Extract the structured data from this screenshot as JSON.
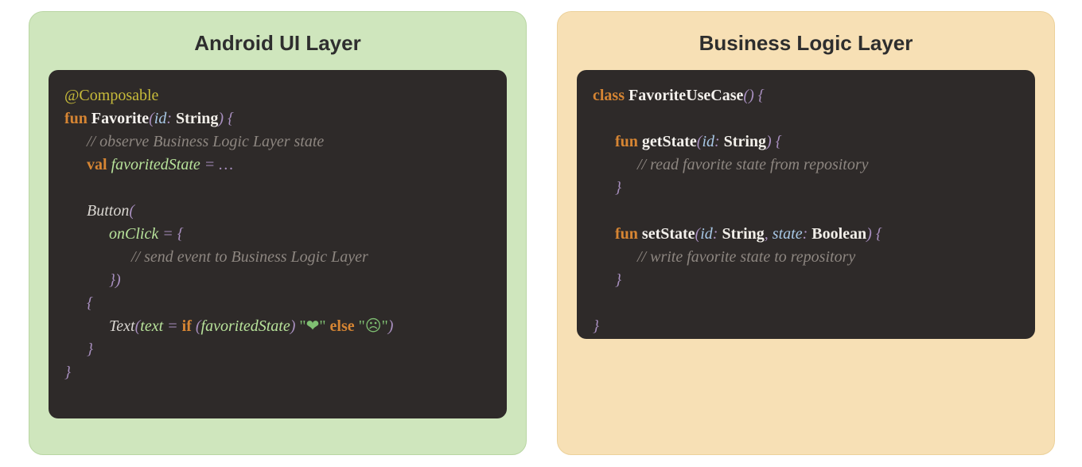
{
  "left": {
    "title": "Android UI Layer",
    "code": {
      "annotation": "@Composable",
      "kw_fun": "fun",
      "fn_name": "Favorite",
      "param_id": "id",
      "type_string": "String",
      "comment_observe": "// observe Business Logic Layer state",
      "kw_val": "val",
      "var_favorited": "favoritedState",
      "equals": " = ",
      "ellipsis": "…",
      "call_button": "Button",
      "lparen": "(",
      "prop_onclick": "onClick",
      "assign_lambda": " = {",
      "comment_send": "// send event to Business Logic Layer",
      "close_lambda": "}",
      "rparen": ")",
      "open_brace": "{",
      "call_text": "Text",
      "prop_text": "text",
      "kw_if": "if",
      "cond_open": " (",
      "cond_var": "favoritedState",
      "cond_close": ") ",
      "str_heart": "\"❤\"",
      "kw_else": "else",
      "str_sad": "\"☹\"",
      "close_brace": "}",
      "outer_close": "}"
    }
  },
  "right": {
    "title": "Business Logic Layer",
    "code": {
      "kw_class": "class",
      "cls_name": "FavoriteUseCase",
      "empty_parens": "()",
      "open": " {",
      "kw_fun": "fun",
      "fn_get": "getState",
      "param_id": "id",
      "type_string": "String",
      "get_open": " {",
      "comment_read": "// read favorite state from repository",
      "close": "}",
      "fn_set": "setState",
      "param_state": "state",
      "type_bool": "Boolean",
      "comment_write": "// write favorite state to repository",
      "outer_close": "}"
    }
  },
  "punct": {
    "colon": ": ",
    "comma": ", ",
    "lparen": "(",
    "rparen": ")",
    "lbrace": " {",
    "rbrace": "}"
  }
}
